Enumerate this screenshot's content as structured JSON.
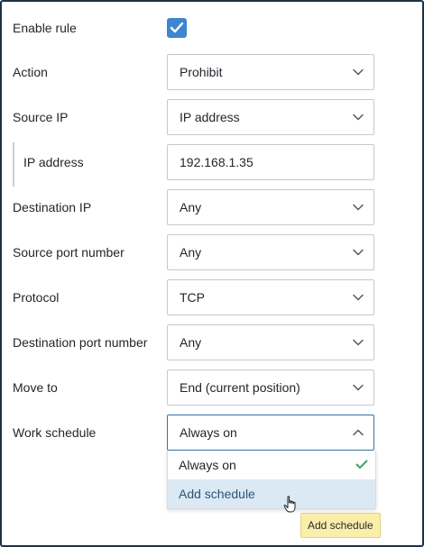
{
  "form": {
    "enable_rule": {
      "label": "Enable rule",
      "checked": true
    },
    "action": {
      "label": "Action",
      "value": "Prohibit"
    },
    "source_ip": {
      "label": "Source IP",
      "value": "IP address"
    },
    "ip_address": {
      "label": "IP address",
      "value": "192.168.1.35"
    },
    "destination_ip": {
      "label": "Destination IP",
      "value": "Any"
    },
    "source_port": {
      "label": "Source port number",
      "value": "Any"
    },
    "protocol": {
      "label": "Protocol",
      "value": "TCP"
    },
    "destination_port": {
      "label": "Destination port number",
      "value": "Any"
    },
    "move_to": {
      "label": "Move to",
      "value": "End (current position)"
    },
    "work_schedule": {
      "label": "Work schedule",
      "value": "Always on",
      "options": [
        {
          "label": "Always on",
          "selected": true
        },
        {
          "label": "Add schedule",
          "selected": false,
          "hovered": true
        }
      ]
    }
  },
  "tooltip": {
    "text": "Add schedule"
  },
  "colors": {
    "accent": "#3c87cf",
    "border": "#1c3348",
    "option_hover_bg": "#dbe9f4",
    "check_green": "#3aa56a",
    "tooltip_bg": "#fbeeaa"
  },
  "icons": {
    "checkbox": "checkmark-icon",
    "select": "chevron-down-icon",
    "select_open": "chevron-up-icon",
    "selected_option": "checkmark-icon",
    "pointer": "hand-cursor-icon"
  }
}
